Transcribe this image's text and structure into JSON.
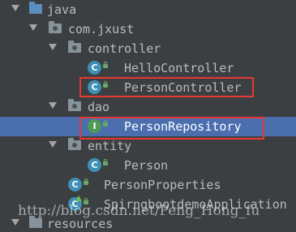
{
  "tree": {
    "java_folder": "java",
    "package_root": "com.jxust",
    "controller_folder": "controller",
    "hello_controller": "HelloController",
    "person_controller": "PersonController",
    "dao_folder": "dao",
    "person_repository": "PersonRepository",
    "entity_folder": "entity",
    "person_class": "Person",
    "person_properties": "PersonProperties",
    "application_class": "SpirngbootdemoApplication",
    "resources_folder": "resources"
  },
  "selected_item": "PersonRepository",
  "badges": {
    "class_letter": "C",
    "interface_letter": "I"
  },
  "watermark": "http://blog.csdn.net/Peng_Hong_fu",
  "colors": {
    "background": "#3c3f41",
    "selection": "#4b6eaf",
    "highlight_border": "#e53935",
    "class_badge": "#3f8fb6",
    "interface_badge": "#4f9a55"
  }
}
